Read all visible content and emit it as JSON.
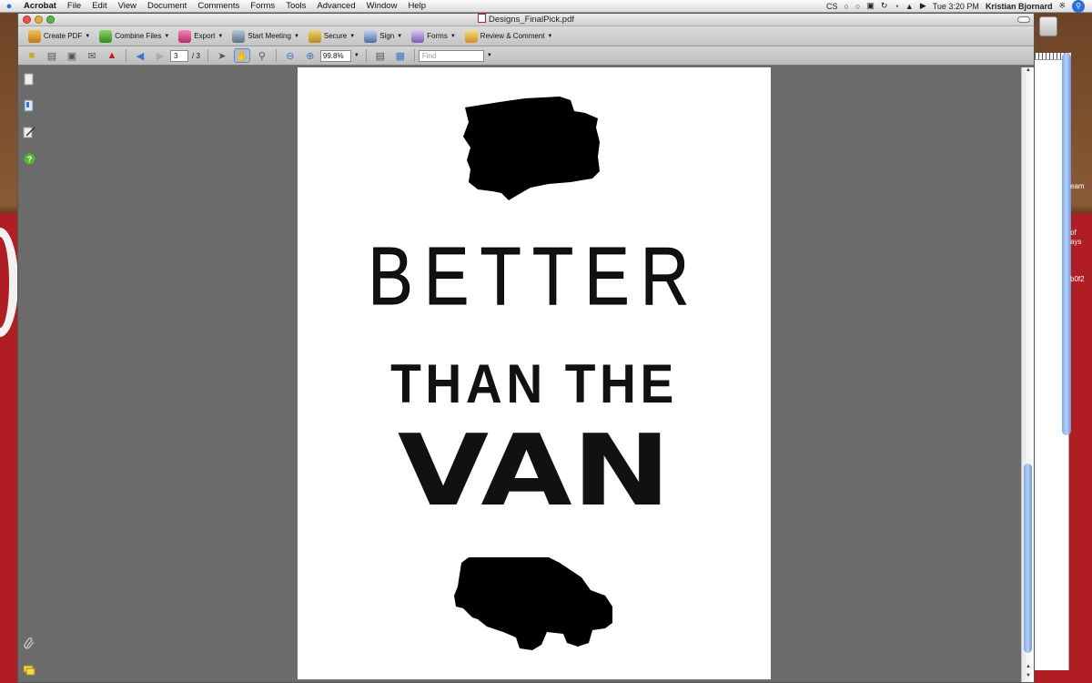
{
  "menubar": {
    "app": "Acrobat",
    "menus": [
      "File",
      "Edit",
      "View",
      "Document",
      "Comments",
      "Forms",
      "Tools",
      "Advanced",
      "Window",
      "Help"
    ],
    "tray_cs": "CS",
    "clock": "Tue 3:20 PM",
    "user": "Kristian Bjornard"
  },
  "window": {
    "title": "Designs_FinalPick.pdf"
  },
  "toolbar": {
    "create_pdf": "Create PDF",
    "combine_files": "Combine Files",
    "export": "Export",
    "start_meeting": "Start Meeting",
    "secure": "Secure",
    "sign": "Sign",
    "forms": "Forms",
    "review_comment": "Review & Comment"
  },
  "nav": {
    "page_number": "3",
    "page_total": "/ 3",
    "zoom": "99.8%",
    "find_placeholder": "Find"
  },
  "document": {
    "line1": "BETTER",
    "line2": "THAN THE",
    "line3": "VAN"
  },
  "background_window": {
    "text1": "eam",
    "text2": "of",
    "text3": "ays",
    "text4": "b0f2"
  },
  "colors": {
    "desktop_red": "#b01e24",
    "toolbar": "#d0d0d0",
    "doc_background": "#6b6b6b",
    "scroll_thumb": "#7ea7e6"
  }
}
